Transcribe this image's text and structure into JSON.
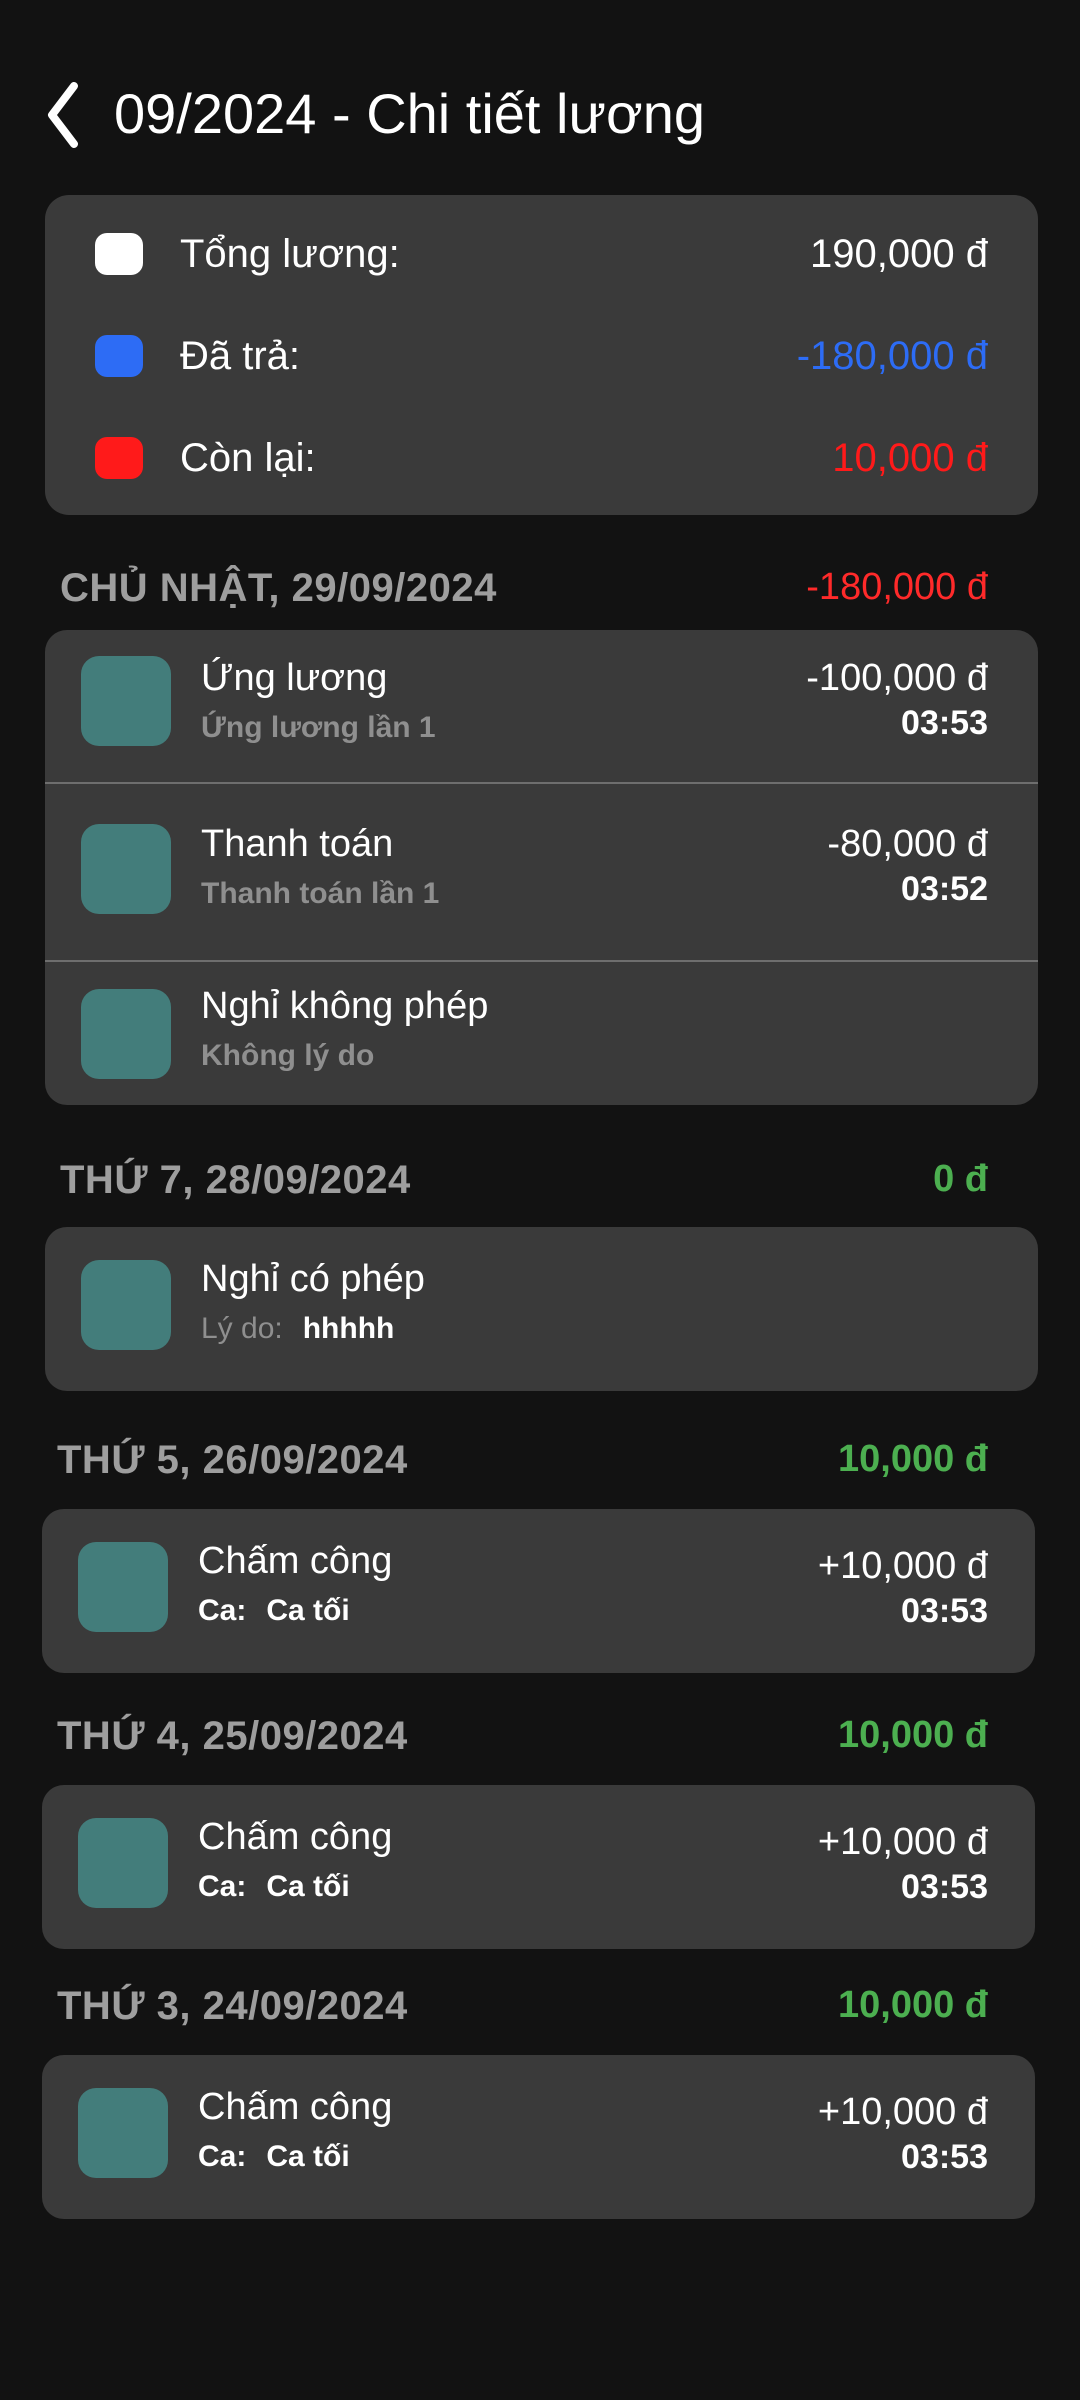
{
  "header": {
    "title": "09/2024 - Chi tiết lương",
    "back_icon": "chevron-left-icon"
  },
  "summary": {
    "total": {
      "label": "Tổng lương:",
      "value": "190,000 đ",
      "color": "#ffffff"
    },
    "paid": {
      "label": "Đã trả:",
      "value": "-180,000 đ",
      "color": "#2d6cf5"
    },
    "remaining": {
      "label": "Còn lại:",
      "value": "10,000 đ",
      "color": "#ff1a1a"
    }
  },
  "colors": {
    "negative": "#ff2a2a",
    "positive": "#4caf50",
    "muted": "#9e9e9e",
    "thumb": "#437d7b"
  },
  "days": [
    {
      "date": "CHỦ NHẬT, 29/09/2024",
      "total": "-180,000 đ",
      "items": [
        {
          "title": "Ứng lương",
          "subtitle": "Ứng lương lần 1",
          "amount": "-100,000 đ",
          "time": "03:53"
        },
        {
          "title": "Thanh toán",
          "subtitle": "Thanh toán lần 1",
          "amount": "-80,000 đ",
          "time": "03:52"
        },
        {
          "title": "Nghỉ không phép",
          "subtitle": "Không lý do"
        }
      ]
    },
    {
      "date": "THỨ 7, 28/09/2024",
      "total": "0 đ",
      "items": [
        {
          "title": "Nghỉ có phép",
          "sub_key": "Lý do:",
          "sub_value": "hhhhh"
        }
      ]
    },
    {
      "date": "THỨ 5, 26/09/2024",
      "total": "10,000 đ",
      "items": [
        {
          "title": "Chấm công",
          "sub_key": "Ca:",
          "sub_value": "Ca tối",
          "amount": "+10,000 đ",
          "time": "03:53"
        }
      ]
    },
    {
      "date": "THỨ 4, 25/09/2024",
      "total": "10,000 đ",
      "items": [
        {
          "title": "Chấm công",
          "sub_key": "Ca:",
          "sub_value": "Ca tối",
          "amount": "+10,000 đ",
          "time": "03:53"
        }
      ]
    },
    {
      "date": "THỨ 3, 24/09/2024",
      "total": "10,000 đ",
      "items": [
        {
          "title": "Chấm công",
          "sub_key": "Ca:",
          "sub_value": "Ca tối",
          "amount": "+10,000 đ",
          "time": "03:53"
        }
      ]
    }
  ]
}
